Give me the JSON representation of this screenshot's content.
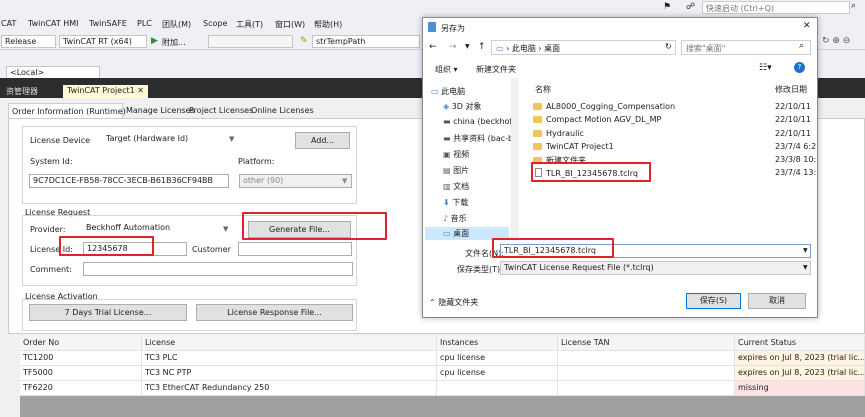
{
  "titlebar": {
    "quick_launch_placeholder": "快速启动 (Ctrl+Q)"
  },
  "menubar": {
    "items": [
      "CAT",
      "TwinCAT HMI",
      "TwinSAFE",
      "PLC",
      "团队(M)",
      "Scope",
      "工具(T)",
      "窗口(W)",
      "帮助(H)"
    ]
  },
  "toolbar": {
    "config": "Release",
    "platform": "TwinCAT RT (x64)",
    "attach": "附加...",
    "symbol_path": "strTempPath",
    "target": "<Local>"
  },
  "doc_tabs": {
    "left": "资管理器",
    "active": "TwinCAT Project1"
  },
  "sub_tabs": [
    "Order Information (Runtime)",
    "Manage Licenses",
    "Project Licenses",
    "Online Licenses"
  ],
  "license_device": {
    "label": "License Device",
    "value": "Target (Hardware Id)",
    "add_button": "Add...",
    "system_id_label": "System Id:",
    "system_id": "9C7DC1CE-FB58-78CC-3ECB-B61B36CF94BB",
    "platform_label": "Platform:",
    "platform": "other (90)"
  },
  "license_request": {
    "title": "License Request",
    "provider_label": "Provider:",
    "provider": "Beckhoff Automation",
    "generate_button": "Generate File...",
    "license_id_label": "License Id:",
    "license_id": "12345678",
    "customer_label": "Customer",
    "comment_label": "Comment:"
  },
  "license_activation": {
    "title": "License Activation",
    "trial_button": "7 Days Trial License...",
    "response_button": "License Response File..."
  },
  "license_table": {
    "columns": [
      "Order No",
      "License",
      "Instances",
      "License TAN",
      "Current Status"
    ],
    "rows": [
      [
        "TC1200",
        "TC3 PLC",
        "cpu license",
        "",
        "expires on Jul 8, 2023 (trial lic..."
      ],
      [
        "TF5000",
        "TC3 NC PTP",
        "cpu license",
        "",
        "expires on Jul 8, 2023 (trial lic..."
      ],
      [
        "TF6220",
        "TC3 EtherCAT Redundancy 250",
        "",
        "",
        "missing"
      ]
    ],
    "status_colors": [
      "#fff4e0",
      "#fff4e0",
      "#fde3e3"
    ]
  },
  "save_dialog": {
    "title": "另存为",
    "breadcrumb": [
      "此电脑",
      "桌面"
    ],
    "search_placeholder": "搜索\"桌面\"",
    "organize": "组织",
    "new_folder": "新建文件夹",
    "col_name": "名称",
    "col_date": "修改日期",
    "tree": [
      "此电脑",
      "3D 对象",
      "china (beckhoff",
      "共享资料 (bac-b",
      "视频",
      "图片",
      "文档",
      "下载",
      "音乐",
      "桌面"
    ],
    "files": [
      {
        "name": "AL8000_Cogging_Compensation",
        "date": "22/10/11",
        "type": "folder"
      },
      {
        "name": "Compact Motion AGV_DL_MP",
        "date": "22/10/11",
        "type": "folder"
      },
      {
        "name": "Hydraulic",
        "date": "22/10/11",
        "type": "folder"
      },
      {
        "name": "TwinCAT Project1",
        "date": "23/7/4 6:2",
        "type": "folder"
      },
      {
        "name": "新建文件夹",
        "date": "23/3/8 10:",
        "type": "folder"
      },
      {
        "name": "TLR_BI_12345678.tclrq",
        "date": "23/7/4 13:",
        "type": "file"
      }
    ],
    "filename_label": "文件名(N):",
    "filename": "TLR_BI_12345678.tclrq",
    "filetype_label": "保存类型(T):",
    "filetype": "TwinCAT License Request File (*.tclrq)",
    "hide_folders": "隐藏文件夹",
    "save_button": "保存(S)",
    "cancel_button": "取消"
  },
  "colors": {
    "highlight": "#e0232a",
    "dark_chrome": "#2d2d30",
    "active_tab": "#fff8d6"
  }
}
